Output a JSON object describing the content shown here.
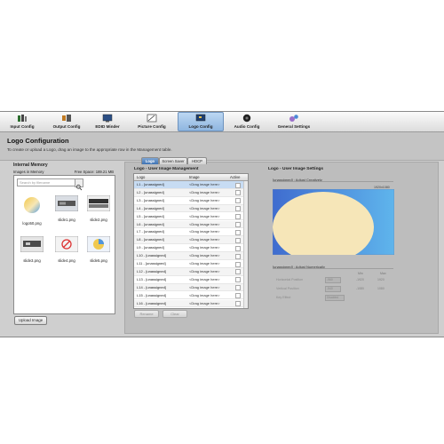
{
  "toolbar": {
    "items": [
      {
        "label": "Input Config",
        "icon": "input-config-icon"
      },
      {
        "label": "Output Config",
        "icon": "output-config-icon"
      },
      {
        "label": "EDID Minder",
        "icon": "edid-minder-icon"
      },
      {
        "label": "Picture Config",
        "icon": "picture-config-icon"
      },
      {
        "label": "Logo Config",
        "icon": "logo-config-icon"
      },
      {
        "label": "Audio Config",
        "icon": "audio-config-icon"
      },
      {
        "label": "General Settings",
        "icon": "general-settings-icon"
      }
    ],
    "active": "Logo Config"
  },
  "page": {
    "title": "Logo Configuration",
    "description": "To create or upload a Logo, drag an image to the appropriate row in the Management table."
  },
  "memory": {
    "title": "Internal Memory",
    "subtitle": "Images in Memory",
    "free_space": "Free Space: 189.21 MB",
    "search_placeholder": "Search by filename",
    "images": [
      {
        "name": "logo50.png"
      },
      {
        "name": "slide1.png"
      },
      {
        "name": "slide2.png"
      },
      {
        "name": "slide3.png"
      },
      {
        "name": "slide4.png"
      },
      {
        "name": "slide5.png"
      }
    ],
    "upload_label": "Upload Image"
  },
  "tabs": [
    {
      "label": "Logo",
      "active": true
    },
    {
      "label": "Screen Saver",
      "active": false
    },
    {
      "label": "HDCP",
      "active": false
    }
  ],
  "management": {
    "title": "Logo - User Image Management",
    "columns": [
      "Logo",
      "Image",
      "Active"
    ],
    "rows": [
      {
        "logo": "L1  -  [unassigned]",
        "image": "<Drag image here>"
      },
      {
        "logo": "L2  -  [unassigned]",
        "image": "<Drag image here>"
      },
      {
        "logo": "L3  -  [unassigned]",
        "image": "<Drag image here>"
      },
      {
        "logo": "L4  -  [unassigned]",
        "image": "<Drag image here>"
      },
      {
        "logo": "L5  -  [unassigned]",
        "image": "<Drag image here>"
      },
      {
        "logo": "L6  -  [unassigned]",
        "image": "<Drag image here>"
      },
      {
        "logo": "L7  -  [unassigned]",
        "image": "<Drag image here>"
      },
      {
        "logo": "L8  -  [unassigned]",
        "image": "<Drag image here>"
      },
      {
        "logo": "L9  -  [unassigned]",
        "image": "<Drag image here>"
      },
      {
        "logo": "L10  -  [unassigned]",
        "image": "<Drag image here>"
      },
      {
        "logo": "L11  -  [unassigned]",
        "image": "<Drag image here>"
      },
      {
        "logo": "L12  -  [unassigned]",
        "image": "<Drag image here>"
      },
      {
        "logo": "L13  -  [unassigned]",
        "image": "<Drag image here>"
      },
      {
        "logo": "L14  -  [unassigned]",
        "image": "<Drag image here>"
      },
      {
        "logo": "L15  -  [unassigned]",
        "image": "<Drag image here>"
      },
      {
        "logo": "L16  -  [unassigned]",
        "image": "<Drag image here>"
      }
    ],
    "buttons": [
      "Rename",
      "Clear"
    ]
  },
  "settings": {
    "title": "Logo - User Image Settings",
    "section1": "[unassigned] : Adjust Creatively",
    "resolution": "1920x1080",
    "section2": "[unassigned] : Adjust Numerically",
    "col_headers": [
      "Min",
      "Max"
    ],
    "fields": [
      {
        "label": "Horizontal Position",
        "value": "-960",
        "min": "-1920",
        "max": "1920"
      },
      {
        "label": "Vertical Position",
        "value": "-540",
        "min": "-1080",
        "max": "1080"
      },
      {
        "label": "Key Effect",
        "value": "Disabled",
        "min": "",
        "max": ""
      }
    ]
  },
  "colors": {
    "accent": "#3f73b4",
    "preview_bg": "#4c7fd4",
    "preview_shape": "#f6e6b8"
  }
}
